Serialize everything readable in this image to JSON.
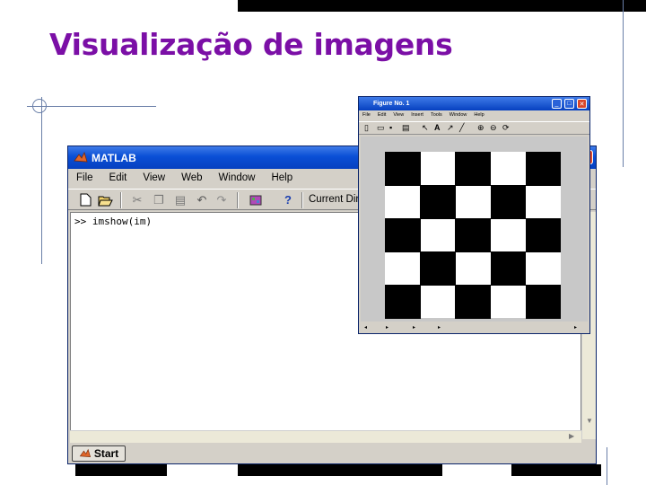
{
  "slide": {
    "title": "Visualização de imagens"
  },
  "matlab": {
    "title": "MATLAB",
    "menu": [
      "File",
      "Edit",
      "View",
      "Web",
      "Window",
      "Help"
    ],
    "current_dir_label": "Current Dir",
    "command": ">> imshow(im)",
    "start_label": "Start"
  },
  "figure": {
    "title": "Figure No. 1",
    "menu": [
      "File",
      "Edit",
      "View",
      "Insert",
      "Tools",
      "Window",
      "Help"
    ],
    "checkerboard": {
      "rows": 5,
      "cols": 5,
      "dark_color": "#000000",
      "light_color": "#ffffff"
    }
  },
  "colors": {
    "title": "#7b0fa6",
    "titlebar": "#0a4fd6",
    "window_bg": "#d4d0c8"
  },
  "icons": [
    "new-file-icon",
    "open-folder-icon",
    "cut-icon",
    "copy-icon",
    "paste-icon",
    "undo-icon",
    "redo-icon",
    "simulink-icon",
    "help-icon"
  ]
}
